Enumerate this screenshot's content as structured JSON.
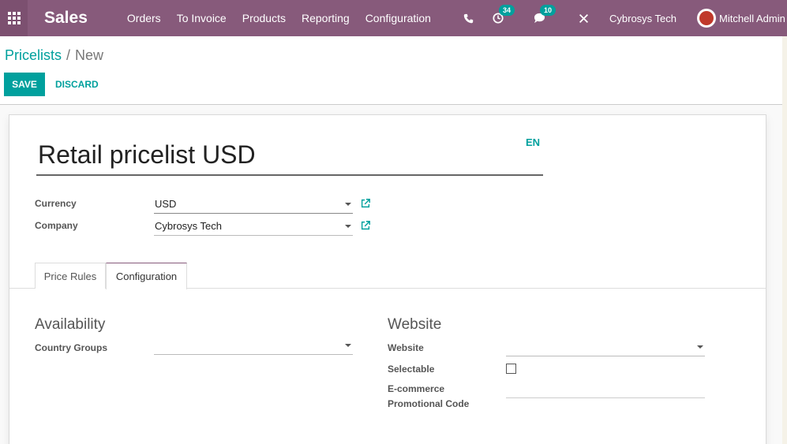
{
  "navbar": {
    "app_name": "Sales",
    "menu": [
      "Orders",
      "To Invoice",
      "Products",
      "Reporting",
      "Configuration"
    ],
    "activity_count": "34",
    "message_count": "10",
    "company": "Cybrosys Tech",
    "user": "Mitchell Admin"
  },
  "breadcrumb": {
    "parent": "Pricelists",
    "current": "New"
  },
  "actions": {
    "save": "SAVE",
    "discard": "DISCARD"
  },
  "form": {
    "name": "Retail pricelist USD",
    "lang": "EN",
    "currency_label": "Currency",
    "currency_value": "USD",
    "company_label": "Company",
    "company_value": "Cybrosys Tech"
  },
  "tabs": [
    "Price Rules",
    "Configuration"
  ],
  "availability": {
    "title": "Availability",
    "country_groups_label": "Country Groups",
    "country_groups_value": ""
  },
  "website": {
    "title": "Website",
    "website_label": "Website",
    "website_value": "",
    "selectable_label": "Selectable",
    "selectable_checked": false,
    "ecommerce_label_line1": "E-commerce",
    "ecommerce_label_line2": "Promotional Code",
    "ecommerce_value": ""
  },
  "colors": {
    "brand": "#875a7b",
    "accent": "#00a09d"
  }
}
